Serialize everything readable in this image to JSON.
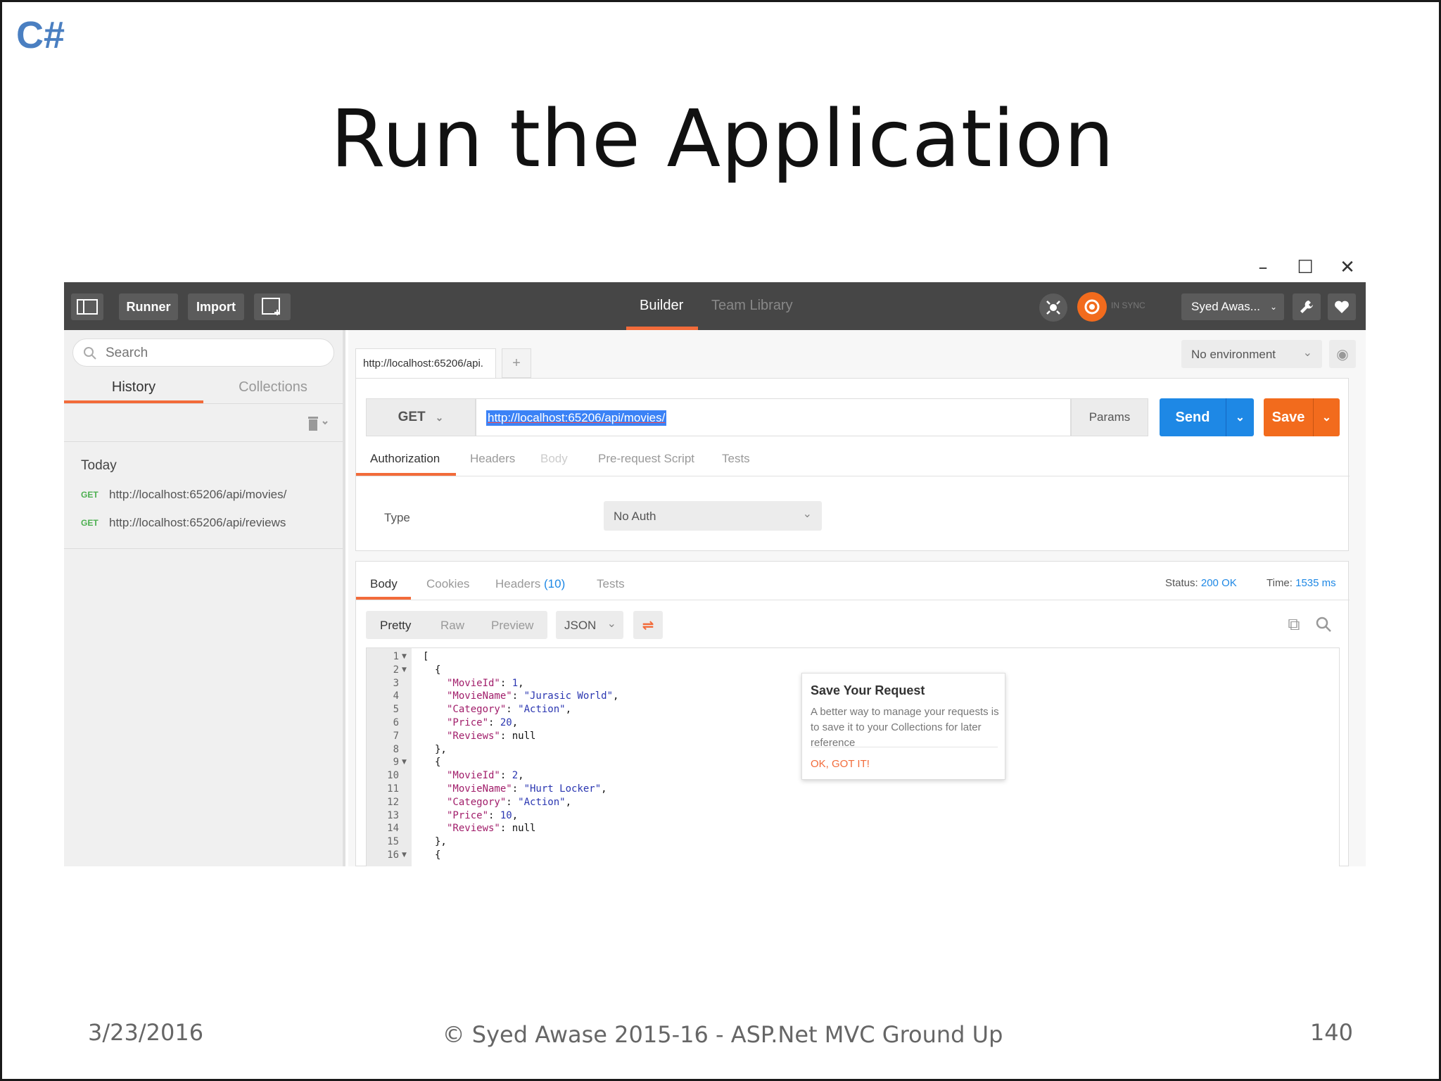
{
  "slide": {
    "logo": "C#",
    "title": "Run the Application",
    "footer_date": "3/23/2016",
    "footer_center": "© Syed Awase 2015-16 - ASP.Net MVC Ground Up",
    "page_number": "140"
  },
  "window_controls": {
    "minimize": "–",
    "maximize": "☐",
    "close": "✕"
  },
  "topbar": {
    "runner": "Runner",
    "import": "Import",
    "tabs": {
      "builder": "Builder",
      "team_library": "Team Library"
    },
    "sync_status": "IN SYNC",
    "user": "Syed Awas...",
    "colors": {
      "bar": "#464646",
      "accent": "#f26b3a"
    }
  },
  "sidebar": {
    "search_placeholder": "Search",
    "tabs": {
      "history": "History",
      "collections": "Collections"
    },
    "group": "Today",
    "items": [
      {
        "method": "GET",
        "url": "http://localhost:65206/api/movies/"
      },
      {
        "method": "GET",
        "url": "http://localhost:65206/api/reviews"
      }
    ]
  },
  "request": {
    "tab_label": "http://localhost:65206/api.",
    "add_tab": "+",
    "environment": "No environment",
    "method": "GET",
    "url": "http://localhost:65206/api/movies/",
    "params": "Params",
    "send": "Send",
    "save": "Save",
    "tabs": [
      "Authorization",
      "Headers",
      "Body",
      "Pre-request Script",
      "Tests"
    ],
    "auth_type_label": "Type",
    "auth_type": "No Auth"
  },
  "popover": {
    "title": "Save Your Request",
    "body": "A better way to manage your requests is to save it to your Collections for later reference",
    "button": "OK, GOT IT!"
  },
  "response": {
    "tabs": {
      "body": "Body",
      "cookies": "Cookies",
      "headers": "Headers",
      "headers_count": "(10)",
      "tests": "Tests"
    },
    "status_label": "Status:",
    "status": "200 OK",
    "time_label": "Time:",
    "time": "1535 ms",
    "views": [
      "Pretty",
      "Raw",
      "Preview"
    ],
    "format": "JSON",
    "code_lines": [
      {
        "n": "1",
        "fold": true,
        "indent": 0,
        "text": "["
      },
      {
        "n": "2",
        "fold": true,
        "indent": 1,
        "text": "{"
      },
      {
        "n": "3",
        "indent": 2,
        "key": "\"MovieId\"",
        "value": "1",
        "tail": ","
      },
      {
        "n": "4",
        "indent": 2,
        "key": "\"MovieName\"",
        "value": "\"Jurasic World\"",
        "tail": ","
      },
      {
        "n": "5",
        "indent": 2,
        "key": "\"Category\"",
        "value": "\"Action\"",
        "tail": ","
      },
      {
        "n": "6",
        "indent": 2,
        "key": "\"Price\"",
        "value": "20",
        "tail": ","
      },
      {
        "n": "7",
        "indent": 2,
        "key": "\"Reviews\"",
        "value": "null",
        "tail": ""
      },
      {
        "n": "8",
        "indent": 1,
        "text": "},"
      },
      {
        "n": "9",
        "fold": true,
        "indent": 1,
        "text": "{"
      },
      {
        "n": "10",
        "indent": 2,
        "key": "\"MovieId\"",
        "value": "2",
        "tail": ","
      },
      {
        "n": "11",
        "indent": 2,
        "key": "\"MovieName\"",
        "value": "\"Hurt Locker\"",
        "tail": ","
      },
      {
        "n": "12",
        "indent": 2,
        "key": "\"Category\"",
        "value": "\"Action\"",
        "tail": ","
      },
      {
        "n": "13",
        "indent": 2,
        "key": "\"Price\"",
        "value": "10",
        "tail": ","
      },
      {
        "n": "14",
        "indent": 2,
        "key": "\"Reviews\"",
        "value": "null",
        "tail": ""
      },
      {
        "n": "15",
        "indent": 1,
        "text": "},"
      },
      {
        "n": "16",
        "fold": true,
        "indent": 1,
        "text": "{"
      }
    ]
  }
}
